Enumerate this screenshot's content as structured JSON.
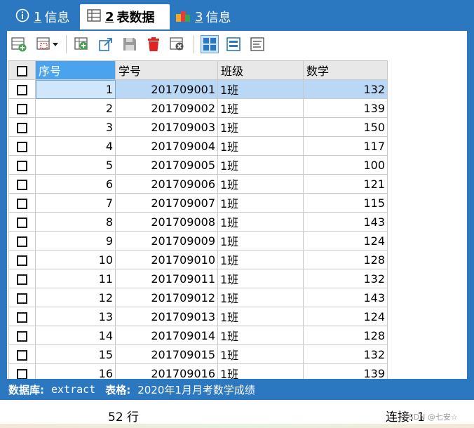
{
  "tabs": [
    {
      "num": "1",
      "label": "信息",
      "icon": "info-icon"
    },
    {
      "num": "2",
      "label": "表数据",
      "icon": "table-icon"
    },
    {
      "num": "3",
      "label": "信息",
      "icon": "chart-icon"
    }
  ],
  "toolbar_icons": [
    "add-record-icon",
    "filter-dropdown-icon",
    "insert-row-icon",
    "export-icon",
    "save-icon",
    "delete-icon",
    "discard-icon",
    "grid-view-icon",
    "form-view-icon",
    "text-view-icon"
  ],
  "table": {
    "columns": [
      "序号",
      "学号",
      "班级",
      "数学"
    ],
    "rows": [
      [
        "1",
        "201709001",
        "1班",
        "132"
      ],
      [
        "2",
        "201709002",
        "1班",
        "139"
      ],
      [
        "3",
        "201709003",
        "1班",
        "150"
      ],
      [
        "4",
        "201709004",
        "1班",
        "117"
      ],
      [
        "5",
        "201709005",
        "1班",
        "100"
      ],
      [
        "6",
        "201709006",
        "1班",
        "121"
      ],
      [
        "7",
        "201709007",
        "1班",
        "115"
      ],
      [
        "8",
        "201709008",
        "1班",
        "143"
      ],
      [
        "9",
        "201709009",
        "1班",
        "124"
      ],
      [
        "10",
        "201709010",
        "1班",
        "128"
      ],
      [
        "11",
        "201709011",
        "1班",
        "132"
      ],
      [
        "12",
        "201709012",
        "1班",
        "143"
      ],
      [
        "13",
        "201709013",
        "1班",
        "124"
      ],
      [
        "14",
        "201709014",
        "1班",
        "128"
      ],
      [
        "15",
        "201709015",
        "1班",
        "132"
      ],
      [
        "16",
        "201709016",
        "1班",
        "139"
      ]
    ]
  },
  "status": {
    "db_label": "数据库:",
    "db_value": "extract",
    "table_label": "表格:",
    "table_value": "2020年1月月考数学成绩"
  },
  "footer": {
    "row_count": "52 行",
    "connection": "连接: 1",
    "watermark": "CSDN @七安☆"
  },
  "colors": {
    "accent": "#2b77c0",
    "selected_header": "#4aa3ec",
    "selected_row": "#b9d8f6"
  }
}
